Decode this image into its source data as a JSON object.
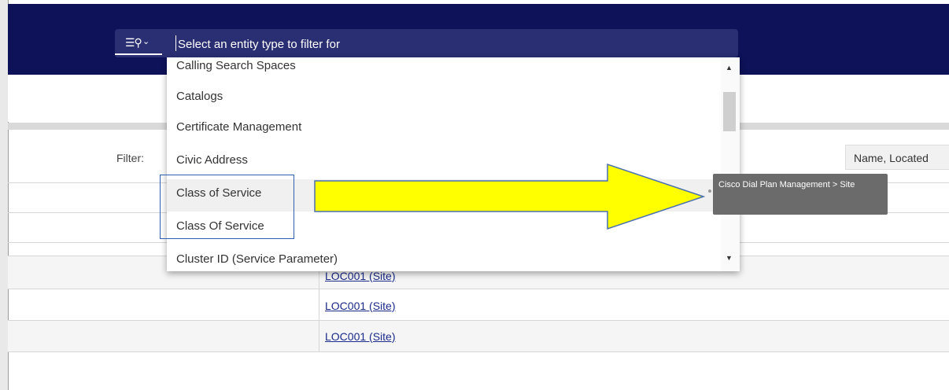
{
  "header": {
    "search": {
      "icon": "list-search-icon",
      "placeholder": "Select an entity type to filter for"
    }
  },
  "filter": {
    "label": "Filter:",
    "columns_value": "Name, Located"
  },
  "dropdown": {
    "items": [
      "Calling Search Spaces",
      "Catalogs",
      "Certificate Management",
      "Civic Address",
      "Class of Service",
      "Class Of Service",
      "Cluster ID (Service Parameter)"
    ]
  },
  "table": {
    "rows": [
      {
        "link": "LOC001 (Site)"
      },
      {
        "link": "LOC001 (Site)"
      },
      {
        "link": "LOC001 (Site)"
      }
    ]
  },
  "tooltip": {
    "text": "Cisco Dial Plan Management > Site"
  },
  "colors": {
    "header": "#0e1259",
    "search_box": "#2a2f73",
    "arrow_fill": "#ffff00",
    "highlight_border": "#2d5fb3",
    "tooltip_bg": "#6b6b6b"
  }
}
